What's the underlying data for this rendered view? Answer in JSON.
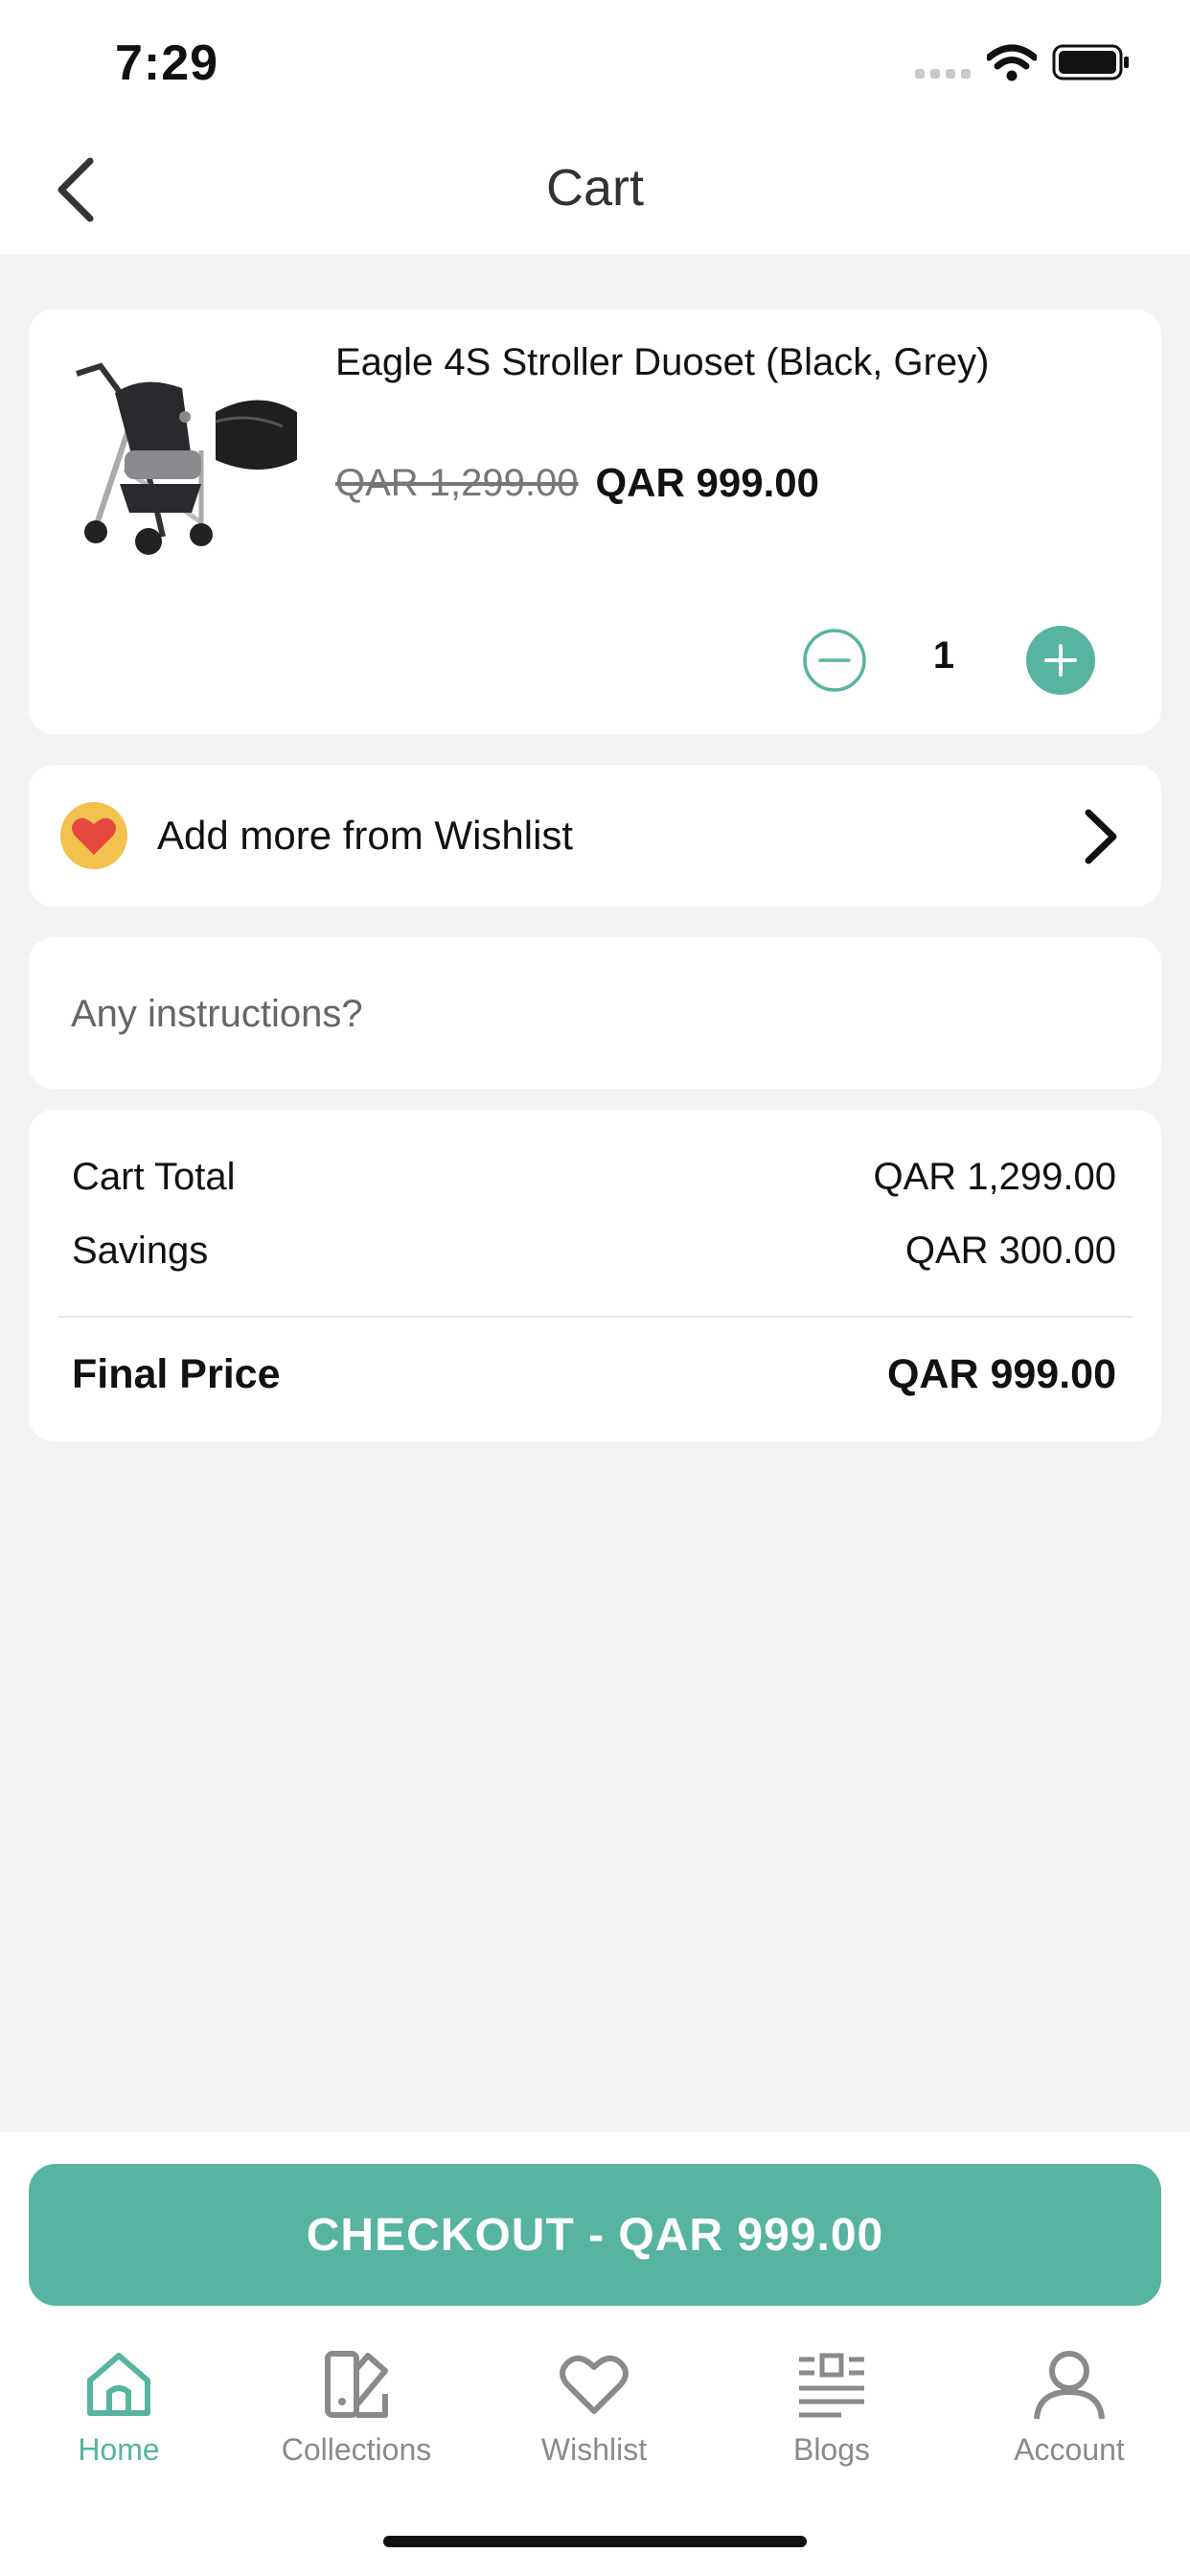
{
  "status_bar": {
    "time": "7:29"
  },
  "header": {
    "title": "Cart"
  },
  "cart_item": {
    "name": "Eagle 4S Stroller Duoset (Black, Grey)",
    "original_price": "QAR 1,299.00",
    "price": "QAR 999.00",
    "quantity": "1"
  },
  "wishlist": {
    "label": "Add more from Wishlist"
  },
  "instructions": {
    "placeholder": "Any instructions?"
  },
  "summary": {
    "cart_total_label": "Cart Total",
    "cart_total_value": "QAR 1,299.00",
    "savings_label": "Savings",
    "savings_value": "QAR 300.00",
    "final_label": "Final Price",
    "final_value": "QAR 999.00"
  },
  "checkout": {
    "label": "CHECKOUT - QAR 999.00"
  },
  "tab_bar": {
    "items": [
      {
        "label": "Home",
        "icon": "home-icon",
        "active": true
      },
      {
        "label": "Collections",
        "icon": "collections-icon",
        "active": false
      },
      {
        "label": "Wishlist",
        "icon": "heart-icon",
        "active": false
      },
      {
        "label": "Blogs",
        "icon": "blogs-icon",
        "active": false
      },
      {
        "label": "Account",
        "icon": "account-icon",
        "active": false
      }
    ]
  },
  "colors": {
    "accent": "#56b4a1",
    "background": "#f3f3f3",
    "card": "#ffffff"
  }
}
